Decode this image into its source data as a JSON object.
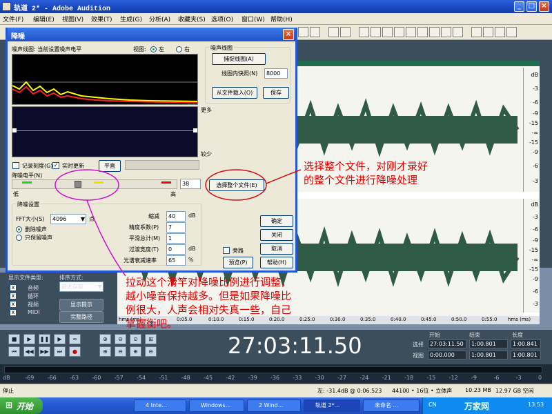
{
  "window": {
    "title": "轨道 2* - Adobe Audition"
  },
  "menu": [
    "文件(F)",
    "编辑(E)",
    "视图(V)",
    "效果(T)",
    "生成(G)",
    "分析(A)",
    "收藏夹(S)",
    "选项(O)",
    "窗口(W)",
    "帮助(H)"
  ],
  "db_scale_top": [
    "dB",
    "-3",
    "-6",
    "-9",
    "-15",
    "-∞",
    "-15",
    "-9",
    "-6",
    "-3"
  ],
  "db_scale_bottom": [
    "dB",
    "-3",
    "-6",
    "-9",
    "-15",
    "-∞",
    "-15",
    "-9",
    "-6",
    "-3"
  ],
  "time_ruler": {
    "unit_left": "hms (ms)",
    "unit_right": "hms (ms)",
    "ticks": [
      "0:05.0",
      "0:10.0",
      "0:15.0",
      "0:20.0",
      "0:25.0",
      "0:30.0",
      "0:35.0",
      "0:40.0",
      "0:45.0",
      "0:50.0",
      "0:55.0"
    ]
  },
  "dialog": {
    "title": "降噪",
    "profile_label": "噪声线图: 当前设置噪声电平",
    "view_label": "视图:",
    "view_left": "左",
    "view_right": "右",
    "profile_group": "噪声线图",
    "capture_button": "捕捉线图(A)",
    "snapshots_label": "线图内快照(N)",
    "snapshots_value": "8000",
    "load_button": "从文件载入(O)",
    "save_button": "保存",
    "more_label": "更多",
    "less_label": "较少",
    "log_scale": "记录刻度(G)",
    "live_update": "实时更新",
    "flat_button": "平直",
    "level_label": "降噪电平(N)",
    "low_label": "低",
    "high_label": "高",
    "level_value": "38",
    "select_all_button": "选择整个文件(E)",
    "settings_group": "降噪设置",
    "fft_label": "FFT大小(S)",
    "fft_value": "4096",
    "fft_unit": "点",
    "remove_noise": "删除噪声",
    "keep_noise": "只保留噪声",
    "reduce_by_label": "缩减",
    "reduce_by_value": "40",
    "reduce_by_unit": "dB",
    "precision_label": "精度系数(P)",
    "precision_value": "7",
    "smoothing_label": "平滑总计(M)",
    "smoothing_value": "1",
    "transition_label": "过渡宽度(T)",
    "transition_value": "0",
    "transition_unit": "dB",
    "spectral_label": "光谱衰减速率",
    "spectral_value": "65",
    "spectral_unit": "%",
    "bypass_label": "旁路",
    "ok_button": "确定",
    "close_button": "关闭",
    "cancel_button": "取消",
    "preview_button": "预览(P)",
    "help_button": "帮助(H)"
  },
  "sidebar": {
    "show_types": "显示文件类型:",
    "sort_by": "排序方式:",
    "sort_value": "最近存取",
    "types": [
      "音频",
      "循环",
      "视频",
      "MIDI"
    ],
    "show_hints": "显示提示",
    "full_path": "完整路径"
  },
  "transport": {
    "timecode": "27:03:11.50",
    "start": "开始",
    "end": "结束",
    "length": "长度",
    "select_label": "选择",
    "view_label": "视图",
    "select_start": "27:03:11.50",
    "select_end": "1:00.801",
    "select_length": "1:00.841",
    "view_start": "0:00.000",
    "view_end": "1:00.801",
    "view_length": "1:00.801"
  },
  "meter_scale": [
    "dB",
    "-69",
    "-66",
    "-63",
    "-60",
    "-57",
    "-54",
    "-51",
    "-48",
    "-45",
    "-42",
    "-39",
    "-36",
    "-33",
    "-30",
    "-27",
    "-24",
    "-21",
    "-18",
    "-15",
    "-12",
    "-9",
    "-6",
    "-3",
    "0"
  ],
  "status": {
    "left": "停止",
    "level": "左: -31.4dB @ 0:06.523",
    "format": "44100 • 16位 • 立体声",
    "size": "10.23 MB",
    "free": "12.97 GB 空闲"
  },
  "taskbar": {
    "start": "开始",
    "tasks": [
      "4 Inte...",
      "Windows...",
      "2 Wind...",
      "轨道 2*...",
      "未命名 ..."
    ],
    "lang": "CN",
    "clock": "13:53",
    "watermark": "万家网"
  },
  "annotations": {
    "note1_line1": "选择整个文件，对刚才录好",
    "note1_line2": "的整个文件进行降噪处理",
    "note2_line1": "拉动这个滑竿对降噪比例进行调整，",
    "note2_line2": "越小噪音保持越多。但是如果降噪比",
    "note2_line3": "例很大，人声会相对失真一些，自己",
    "note2_line4": "掌握衡吧。"
  },
  "colors": {
    "accent": "#2457d8",
    "annotation": "#e00000",
    "waveform": "#2f5a45"
  }
}
